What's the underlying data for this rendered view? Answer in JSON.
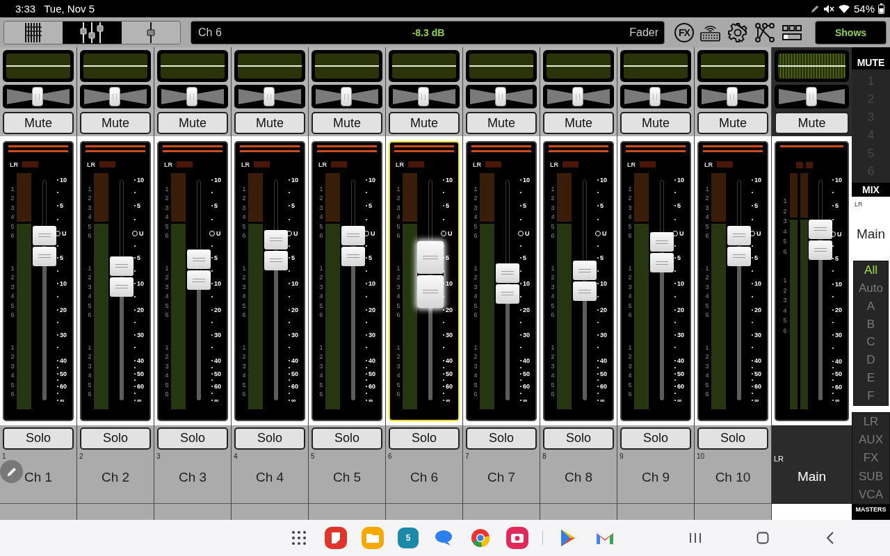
{
  "status_bar": {
    "time": "3:33",
    "date": "Tue, Nov 5",
    "battery": "54%"
  },
  "toolbar": {
    "view_modes": [
      {
        "kind": "grid",
        "selected": false
      },
      {
        "kind": "faders",
        "selected": true
      },
      {
        "kind": "single",
        "selected": false
      }
    ],
    "display": {
      "channel": "Ch 6",
      "value": "-8.3 dB",
      "parameter": "Fader"
    },
    "fx_label": "FX",
    "shows_label": "Shows"
  },
  "channels": [
    {
      "number": "1",
      "name": "Ch 1",
      "selected": false,
      "mute": {
        "label": "Mute",
        "on": false
      },
      "solo": {
        "label": "Solo",
        "on": false
      },
      "pan": {
        "level": 0.5
      },
      "fader": {
        "level": 0.7
      },
      "bus_label": "LR",
      "meter_labels": [
        [
          "1",
          "2",
          "3",
          "4",
          "5",
          "6"
        ],
        [
          "1",
          "2",
          "3",
          "4",
          "5",
          "6"
        ],
        [
          "1",
          "2",
          "3",
          "4",
          "5",
          "6"
        ]
      ],
      "scale": [
        "10",
        "5",
        "U",
        "5",
        "10",
        "20",
        "30",
        "40",
        "50",
        "60",
        "∞"
      ]
    },
    {
      "number": "2",
      "name": "Ch 2",
      "selected": false,
      "mute": {
        "label": "Mute",
        "on": false
      },
      "solo": {
        "label": "Solo",
        "on": false
      },
      "pan": {
        "level": 0.5
      },
      "fader": {
        "level": 0.56
      },
      "bus_label": "LR",
      "meter_labels": [
        [
          "1",
          "2",
          "3",
          "4",
          "5",
          "6"
        ],
        [
          "1",
          "2",
          "3",
          "4",
          "5",
          "6"
        ],
        [
          "1",
          "2",
          "3",
          "4",
          "5",
          "6"
        ]
      ],
      "scale": [
        "10",
        "5",
        "U",
        "5",
        "10",
        "20",
        "30",
        "40",
        "50",
        "60",
        "∞"
      ]
    },
    {
      "number": "3",
      "name": "Ch 3",
      "selected": false,
      "mute": {
        "label": "Mute",
        "on": false
      },
      "solo": {
        "label": "Solo",
        "on": false
      },
      "pan": {
        "level": 0.5
      },
      "fader": {
        "level": 0.59
      },
      "bus_label": "LR",
      "meter_labels": [
        [
          "1",
          "2",
          "3",
          "4",
          "5",
          "6"
        ],
        [
          "1",
          "2",
          "3",
          "4",
          "5",
          "6"
        ],
        [
          "1",
          "2",
          "3",
          "4",
          "5",
          "6"
        ]
      ],
      "scale": [
        "10",
        "5",
        "U",
        "5",
        "10",
        "20",
        "30",
        "40",
        "50",
        "60",
        "∞"
      ]
    },
    {
      "number": "4",
      "name": "Ch 4",
      "selected": false,
      "mute": {
        "label": "Mute",
        "on": false
      },
      "solo": {
        "label": "Solo",
        "on": false
      },
      "pan": {
        "level": 0.5
      },
      "fader": {
        "level": 0.68
      },
      "bus_label": "LR",
      "meter_labels": [
        [
          "1",
          "2",
          "3",
          "4",
          "5",
          "6"
        ],
        [
          "1",
          "2",
          "3",
          "4",
          "5",
          "6"
        ],
        [
          "1",
          "2",
          "3",
          "4",
          "5",
          "6"
        ]
      ],
      "scale": [
        "10",
        "5",
        "U",
        "5",
        "10",
        "20",
        "30",
        "40",
        "50",
        "60",
        "∞"
      ]
    },
    {
      "number": "5",
      "name": "Ch 5",
      "selected": false,
      "mute": {
        "label": "Mute",
        "on": false
      },
      "solo": {
        "label": "Solo",
        "on": false
      },
      "pan": {
        "level": 0.5
      },
      "fader": {
        "level": 0.7
      },
      "bus_label": "LR",
      "meter_labels": [
        [
          "1",
          "2",
          "3",
          "4",
          "5",
          "6"
        ],
        [
          "1",
          "2",
          "3",
          "4",
          "5",
          "6"
        ],
        [
          "1",
          "2",
          "3",
          "4",
          "5",
          "6"
        ]
      ],
      "scale": [
        "10",
        "5",
        "U",
        "5",
        "10",
        "20",
        "30",
        "40",
        "50",
        "60",
        "∞"
      ]
    },
    {
      "number": "6",
      "name": "Ch 6",
      "selected": true,
      "mute": {
        "label": "Mute",
        "on": false
      },
      "solo": {
        "label": "Solo",
        "on": false
      },
      "pan": {
        "level": 0.5
      },
      "fader": {
        "level": 0.57
      },
      "bus_label": "LR",
      "meter_labels": [
        [
          "1",
          "2",
          "3",
          "4",
          "5",
          "6"
        ],
        [
          "1",
          "2",
          "3",
          "4",
          "5",
          "6"
        ],
        [
          "1",
          "2",
          "3",
          "4",
          "5",
          "6"
        ]
      ],
      "scale": [
        "10",
        "5",
        "U",
        "5",
        "10",
        "20",
        "30",
        "40",
        "50",
        "60",
        "∞"
      ]
    },
    {
      "number": "7",
      "name": "Ch 7",
      "selected": false,
      "mute": {
        "label": "Mute",
        "on": false
      },
      "solo": {
        "label": "Solo",
        "on": false
      },
      "pan": {
        "level": 0.5
      },
      "fader": {
        "level": 0.53
      },
      "bus_label": "LR",
      "meter_labels": [
        [
          "1",
          "2",
          "3",
          "4",
          "5",
          "6"
        ],
        [
          "1",
          "2",
          "3",
          "4",
          "5",
          "6"
        ],
        [
          "1",
          "2",
          "3",
          "4",
          "5",
          "6"
        ]
      ],
      "scale": [
        "10",
        "5",
        "U",
        "5",
        "10",
        "20",
        "30",
        "40",
        "50",
        "60",
        "∞"
      ]
    },
    {
      "number": "8",
      "name": "Ch 8",
      "selected": false,
      "mute": {
        "label": "Mute",
        "on": false
      },
      "solo": {
        "label": "Solo",
        "on": false
      },
      "pan": {
        "level": 0.5
      },
      "fader": {
        "level": 0.54
      },
      "bus_label": "LR",
      "meter_labels": [
        [
          "1",
          "2",
          "3",
          "4",
          "5",
          "6"
        ],
        [
          "1",
          "2",
          "3",
          "4",
          "5",
          "6"
        ],
        [
          "1",
          "2",
          "3",
          "4",
          "5",
          "6"
        ]
      ],
      "scale": [
        "10",
        "5",
        "U",
        "5",
        "10",
        "20",
        "30",
        "40",
        "50",
        "60",
        "∞"
      ]
    },
    {
      "number": "9",
      "name": "Ch 9",
      "selected": false,
      "mute": {
        "label": "Mute",
        "on": false
      },
      "solo": {
        "label": "Solo",
        "on": false
      },
      "pan": {
        "level": 0.5
      },
      "fader": {
        "level": 0.67
      },
      "bus_label": "LR",
      "meter_labels": [
        [
          "1",
          "2",
          "3",
          "4",
          "5",
          "6"
        ],
        [
          "1",
          "2",
          "3",
          "4",
          "5",
          "6"
        ],
        [
          "1",
          "2",
          "3",
          "4",
          "5",
          "6"
        ]
      ],
      "scale": [
        "10",
        "5",
        "U",
        "5",
        "10",
        "20",
        "30",
        "40",
        "50",
        "60",
        "∞"
      ]
    },
    {
      "number": "10",
      "name": "Ch 10",
      "selected": false,
      "mute": {
        "label": "Mute",
        "on": false
      },
      "solo": {
        "label": "Solo",
        "on": false
      },
      "pan": {
        "level": 0.5
      },
      "fader": {
        "level": 0.7
      },
      "bus_label": "LR",
      "meter_labels": [
        [
          "1",
          "2",
          "3",
          "4",
          "5",
          "6"
        ],
        [
          "1",
          "2",
          "3",
          "4",
          "5",
          "6"
        ],
        [
          "1",
          "2",
          "3",
          "4",
          "5",
          "6"
        ]
      ],
      "scale": [
        "10",
        "5",
        "U",
        "5",
        "10",
        "20",
        "30",
        "40",
        "50",
        "60",
        "∞"
      ]
    }
  ],
  "master": {
    "tag": "LR",
    "name": "Main",
    "mute": {
      "label": "Mute",
      "on": false
    },
    "pan": {
      "level": 0.5
    },
    "fader": {
      "level": 0.73
    },
    "meter_labels": [
      [
        "1",
        "2",
        "3",
        "4",
        "5",
        "6"
      ],
      [
        "1",
        "2",
        "3",
        "4",
        "5",
        "6"
      ]
    ],
    "scale": [
      "10",
      "5",
      "U",
      "5",
      "10",
      "20",
      "30",
      "40",
      "50",
      "60",
      "∞"
    ]
  },
  "sidebar": {
    "mute_title": "MUTE",
    "mute_groups": [
      {
        "label": "1",
        "on": false
      },
      {
        "label": "2",
        "on": false
      },
      {
        "label": "3",
        "on": false
      },
      {
        "label": "4",
        "on": false
      },
      {
        "label": "5",
        "on": false
      },
      {
        "label": "6",
        "on": false
      }
    ],
    "mix_title": "MIX",
    "mix": {
      "tag": "LR",
      "name": "Main"
    },
    "filters": [
      {
        "label": "All",
        "selected": true
      },
      {
        "label": "Auto",
        "selected": false
      },
      {
        "label": "A",
        "selected": false
      },
      {
        "label": "B",
        "selected": false
      },
      {
        "label": "C",
        "selected": false
      },
      {
        "label": "D",
        "selected": false
      },
      {
        "label": "E",
        "selected": false
      },
      {
        "label": "F",
        "selected": false
      }
    ],
    "masters": [
      {
        "label": "LR",
        "selected": false
      },
      {
        "label": "AUX",
        "selected": false
      },
      {
        "label": "FX",
        "selected": false
      },
      {
        "label": "SUB",
        "selected": false
      },
      {
        "label": "VCA",
        "selected": false
      }
    ],
    "masters_title": "MASTERS"
  },
  "taskbar": {
    "apps": [
      {
        "kind": "apps"
      },
      {
        "kind": "notes"
      },
      {
        "kind": "files"
      },
      {
        "kind": "calendar",
        "label": "5"
      },
      {
        "kind": "messages"
      },
      {
        "kind": "browser"
      },
      {
        "kind": "camera"
      },
      {
        "kind": "divider"
      },
      {
        "kind": "store"
      },
      {
        "kind": "mail"
      }
    ]
  }
}
